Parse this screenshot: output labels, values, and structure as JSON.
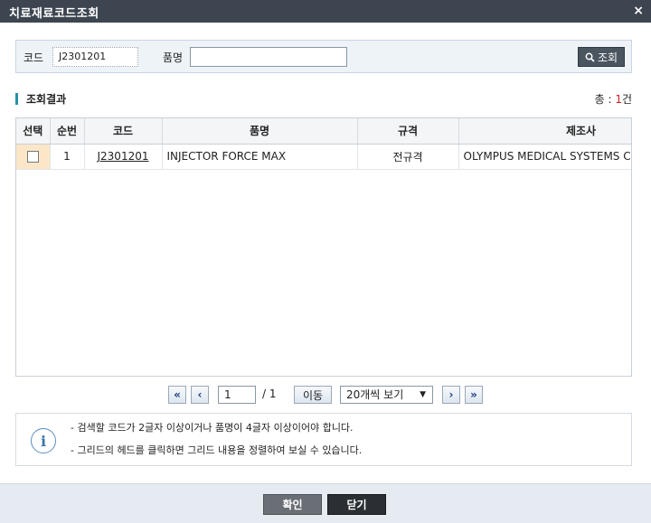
{
  "window": {
    "title": "치료재료코드조회",
    "close_glyph": "×"
  },
  "search": {
    "code_label": "코드",
    "code_value": "J2301201",
    "name_label": "품명",
    "name_value": "",
    "search_button": "조회",
    "search_icon_glyph": "🔍"
  },
  "results": {
    "section_label": "조회결과",
    "total_prefix": "총 : ",
    "total_count": "1",
    "total_suffix": "건"
  },
  "grid": {
    "headers": [
      "선택",
      "순번",
      "코드",
      "품명",
      "규격",
      "제조사"
    ],
    "rows": [
      {
        "selected": false,
        "no": "1",
        "code": "J2301201",
        "name": "INJECTOR FORCE MAX",
        "spec": "전규격",
        "maker": "OLYMPUS MEDICAL SYSTEMS CORP."
      }
    ]
  },
  "pager": {
    "first": "«",
    "prev": "‹",
    "page_value": "1",
    "total_pages": "/ 1",
    "go_button": "이동",
    "page_size": "20개씩 보기",
    "next": "›",
    "last": "»"
  },
  "info": {
    "lines": [
      "- 검색할 코드가 2글자 이상이거나 품명이 4글자 이상이어야 합니다.",
      "- 그리드의 헤드를 클릭하면 그리드 내용을 정렬하여 보실 수 있습니다."
    ]
  },
  "footer": {
    "ok_button": "확인",
    "close_button": "닫기"
  }
}
